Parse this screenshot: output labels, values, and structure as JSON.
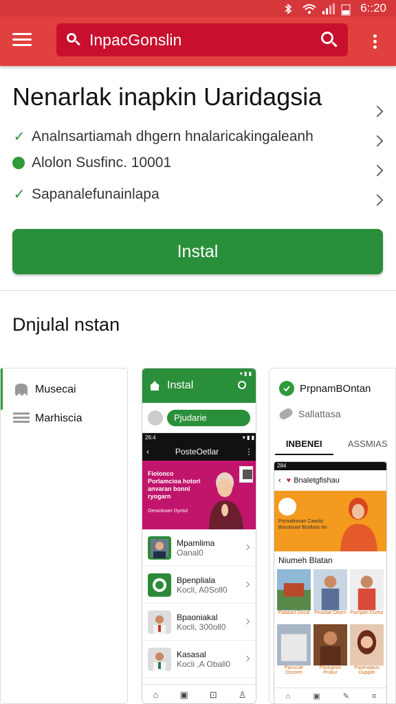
{
  "status_bar": {
    "time": "6::20"
  },
  "app_bar": {
    "search_text": "InpacGonslin"
  },
  "title": "Nenarlak inapkin Uaridagsia",
  "features": [
    {
      "text": "Analnsartiamah dhgern hnalaricakingaleanh",
      "mark": "✓"
    },
    {
      "text": "Alolon Susfinc. 10001",
      "mark": "dot"
    },
    {
      "text": "Sapanalefunainlapa",
      "mark": "✓"
    }
  ],
  "install_button": "Instal",
  "section_title": "Dnjulal nstan",
  "left_card": {
    "items": [
      "Musecai",
      "Marhiscia"
    ]
  },
  "phone_mid": {
    "header": "Instal",
    "pill": "Pjudarie",
    "inner_status": "26:4",
    "inner_title": "PosteOetlar",
    "banner_text": "Fiolonco Porlamcioa hotorl anvaran bonnl ryogarn",
    "banner_caption": "Oessntuser Oyntul",
    "rows": [
      {
        "title": "Mpamlima",
        "subtitle": "Oanal0"
      },
      {
        "title": "Bpenpliala",
        "subtitle": "Kocli, A0Soll0"
      },
      {
        "title": "Bpaoniakal",
        "subtitle": "Kocli, 300oll0"
      },
      {
        "title": "Kasasal",
        "subtitle": "Kocli ,A Oball0"
      }
    ]
  },
  "phone_right": {
    "row1": "PrpnamBOntan",
    "row2": "Sallattasa",
    "tabs": [
      "INBENEI",
      "ASSMIAS"
    ],
    "inner_status": "284",
    "inner_title": "Bnaletgfishau",
    "banner_text": "Pscnatinrsan Caanlic Bocolsuse Bosllunc trn",
    "section": "Niumeh Blatan",
    "grid_captions": [
      "Patatanl Oocal",
      "Pesolae Oepm",
      "Parnpan Ourfur",
      "Pacucalr Oscorm",
      "Pasegean Prokur",
      "Pasenalaus Ouppiln"
    ]
  },
  "colors": {
    "accent": "#e0413f",
    "search_bg": "#c8102e",
    "primary": "#2a8f3a"
  }
}
